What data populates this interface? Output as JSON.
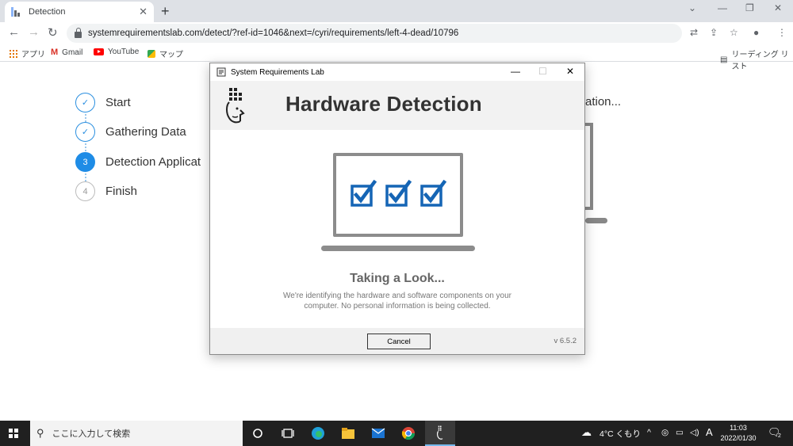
{
  "browser": {
    "tab_title": "Detection",
    "tab_close": "✕",
    "new_tab": "+",
    "url": "systemrequirementslab.com/detect/?ref-id=1046&next=/cyri/requirements/left-4-dead/10796",
    "window_controls": {
      "minimize": "—",
      "restore": "❐",
      "close": "✕"
    }
  },
  "bookmarks": {
    "items": [
      {
        "label": "アプリ",
        "icon": "apps-grid-icon"
      },
      {
        "label": "Gmail",
        "icon": "gmail-icon"
      },
      {
        "label": "YouTube",
        "icon": "youtube-icon"
      },
      {
        "label": "マップ",
        "icon": "maps-icon"
      }
    ],
    "reading_list": "リーディング リスト"
  },
  "page": {
    "steps": [
      {
        "number": "✓",
        "label": "Start",
        "state": "done"
      },
      {
        "number": "✓",
        "label": "Gathering Data",
        "state": "done"
      },
      {
        "number": "3",
        "label": "Detection Applicat",
        "state": "active"
      },
      {
        "number": "4",
        "label": "Finish",
        "state": "pending"
      }
    ],
    "right_heading_fragment": "ation..."
  },
  "dialog": {
    "window_title": "System Requirements Lab",
    "heading": "Hardware Detection",
    "status_title": "Taking a Look...",
    "status_line1": "We're identifying the hardware and software components on your",
    "status_line2": "computer. No personal information is being collected.",
    "cancel_label": "Cancel",
    "version": "v 6.5.2",
    "controls": {
      "minimize": "—",
      "maximize": "☐",
      "close": "✕"
    },
    "accent_color": "#1565b5"
  },
  "taskbar": {
    "search_placeholder": "ここに入力して検索",
    "weather": "4°C くもり",
    "ime": "A",
    "time": "11:03",
    "date": "2022/01/30",
    "notification_count": "2"
  }
}
